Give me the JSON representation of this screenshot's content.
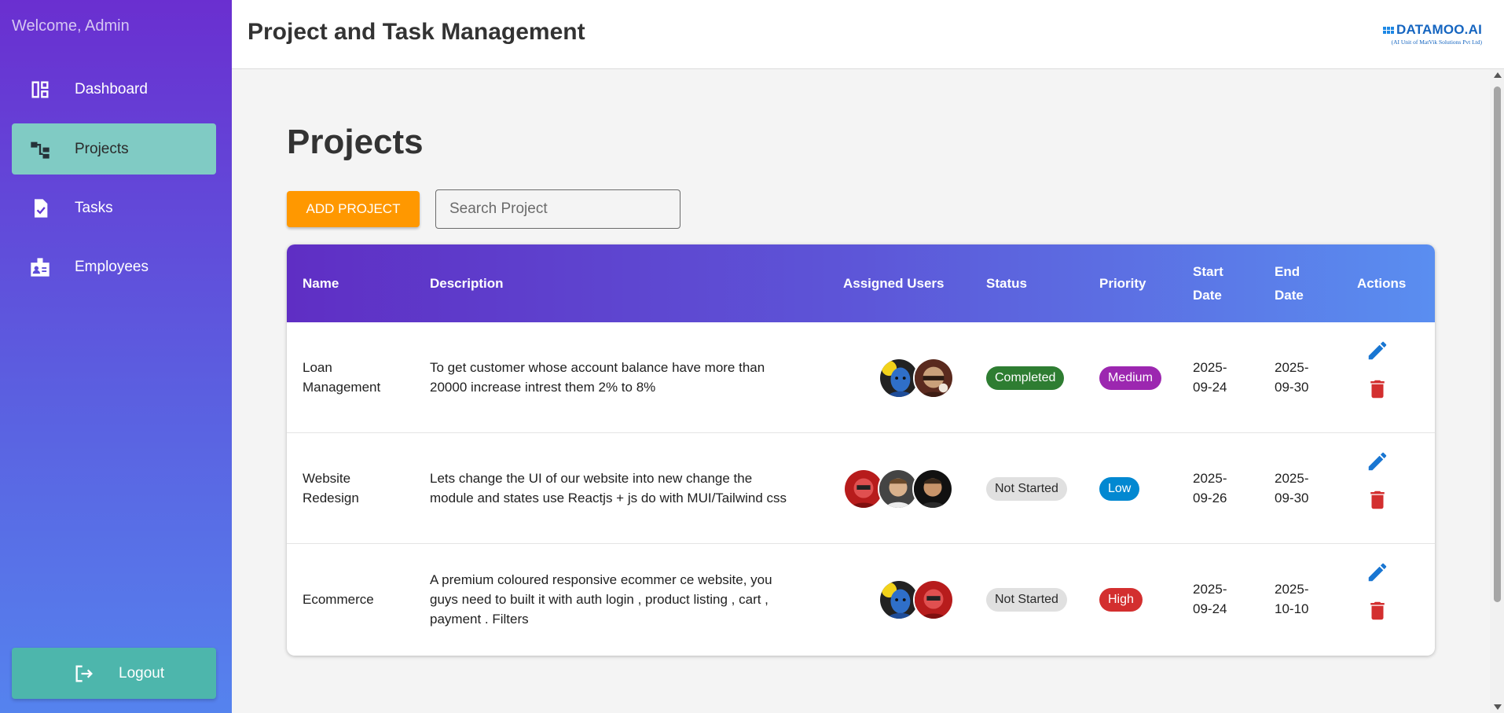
{
  "sidebar": {
    "welcome": "Welcome, Admin",
    "items": [
      {
        "label": "Dashboard",
        "icon": "dashboard-icon"
      },
      {
        "label": "Projects",
        "icon": "project-tree-icon",
        "active": true
      },
      {
        "label": "Tasks",
        "icon": "task-check-icon"
      },
      {
        "label": "Employees",
        "icon": "badge-icon"
      }
    ],
    "logout_label": "Logout",
    "active_color": "#80cbc4",
    "logout_color": "#4db6ac"
  },
  "header": {
    "title": "Project and Task Management",
    "brand": "DATAMOO.AI",
    "brand_sub": "(AI Unit of MatVik Solutions Pvt Ltd)"
  },
  "main": {
    "page_title": "Projects",
    "add_button": "ADD PROJECT",
    "search_placeholder": "Search Project",
    "columns": {
      "name": "Name",
      "description": "Description",
      "assigned_users": "Assigned Users",
      "status": "Status",
      "priority": "Priority",
      "start_date_1": "Start",
      "start_date_2": "Date",
      "end_date_1": "End",
      "end_date_2": "Date",
      "actions": "Actions"
    },
    "rows": [
      {
        "name_1": "Loan",
        "name_2": "Management",
        "desc_1": "To get customer whose account balance have more than",
        "desc_2": "20000 increase intrest them 2% to 8%",
        "desc_3": "",
        "users": [
          "avatar-blue-face",
          "avatar-masked-face"
        ],
        "status": "Completed",
        "priority": "Medium",
        "start_1": "2025-",
        "start_2": "09-24",
        "end_1": "2025-",
        "end_2": "09-30"
      },
      {
        "name_1": "Website",
        "name_2": "Redesign",
        "desc_1": "Lets change the UI of our website into new change the",
        "desc_2": "module and states use Reactjs + js do with MUI/Tailwind css",
        "desc_3": "",
        "users": [
          "avatar-red-robot",
          "avatar-man-1",
          "avatar-man-2"
        ],
        "status": "Not Started",
        "priority": "Low",
        "start_1": "2025-",
        "start_2": "09-26",
        "end_1": "2025-",
        "end_2": "09-30"
      },
      {
        "name_1": "Ecommerce",
        "name_2": "",
        "desc_1": "A premium coloured responsive ecommer ce website, you",
        "desc_2": "guys need to built it with auth login , product listing , cart ,",
        "desc_3": "payment . Filters",
        "users": [
          "avatar-blue-face",
          "avatar-red-robot"
        ],
        "status": "Not Started",
        "priority": "High",
        "start_1": "2025-",
        "start_2": "09-24",
        "end_1": "2025-",
        "end_2": "10-10"
      }
    ],
    "colors": {
      "add_button": "#ff9800",
      "completed": "#2e7d32",
      "not_started": "#e0e0e0",
      "medium": "#9c27b0",
      "low": "#0288d1",
      "high": "#d32f2f",
      "edit_icon": "#1976d2",
      "delete_icon": "#d32f2f"
    }
  }
}
